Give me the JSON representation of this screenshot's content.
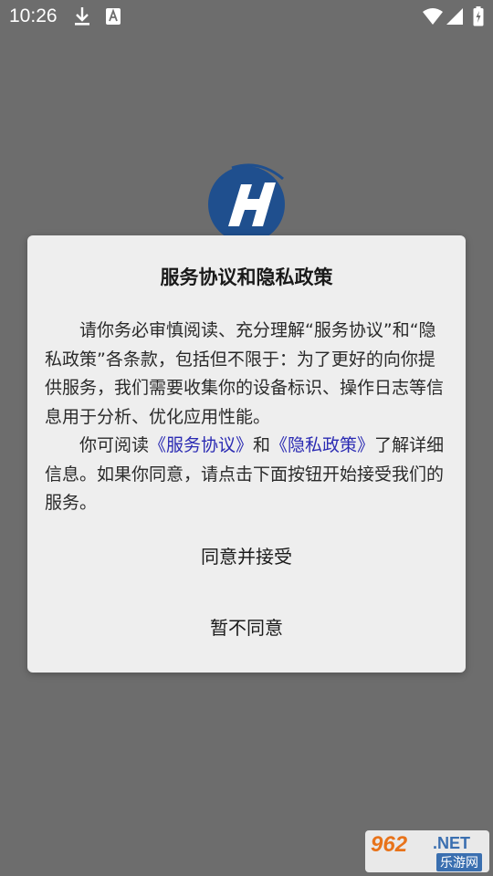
{
  "status_bar": {
    "time": "10:26",
    "icons": [
      "download-icon",
      "text-a-icon",
      "wifi-icon",
      "signal-icon",
      "battery-charging-icon"
    ],
    "color": "#ffffff"
  },
  "app_logo": {
    "name": "app-logo",
    "colors": [
      "#1f4f8e",
      "#ffffff"
    ]
  },
  "dialog": {
    "title": "服务协议和隐私政策",
    "paragraph1": "请你务必审慎阅读、充分理解“服务协议”和“隐私政策”各条款，包括但不限于：为了更好的向你提供服务，我们需要收集你的设备标识、操作日志等信息用于分析、优化应用性能。",
    "paragraph2_prefix": "你可阅读",
    "service_link": "《服务协议》",
    "paragraph2_and": "和",
    "privacy_link": "《隐私政策》",
    "paragraph2_suffix": "了解详细信息。如果你同意，请点击下面按钮开始接受我们的服务。",
    "agree_label": "同意并接受",
    "disagree_label": "暂不同意",
    "link_color": "#2b2bb3",
    "background": "#eeeeee"
  },
  "watermark": {
    "brand": "962",
    "net": ".NET",
    "site": "乐游网"
  },
  "overlay_color": "#6d6d6d"
}
